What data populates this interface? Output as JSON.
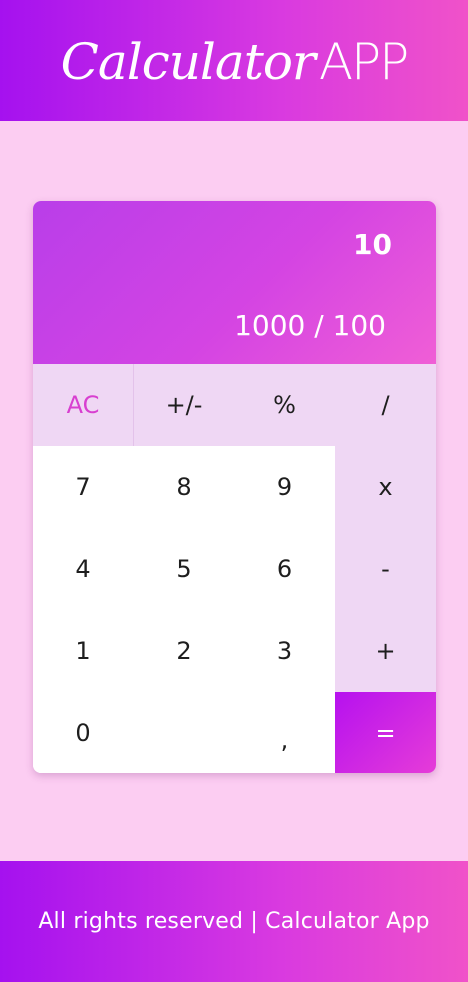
{
  "header": {
    "title_script": "Calculator",
    "title_app": "APP"
  },
  "display": {
    "result": "10",
    "expression": "1000 / 100"
  },
  "keys": {
    "ac": "AC",
    "sign": "+/-",
    "percent": "%",
    "divide": "/",
    "seven": "7",
    "eight": "8",
    "nine": "9",
    "multiply": "x",
    "four": "4",
    "five": "5",
    "six": "6",
    "minus": "-",
    "one": "1",
    "two": "2",
    "three": "3",
    "plus": "+",
    "zero": "0",
    "comma": ",",
    "equals": "="
  },
  "footer": {
    "text": "All rights reserved | Calculator App"
  },
  "colors": {
    "background": "#fccdf2",
    "accent_start": "#a511ef",
    "accent_end": "#f052c9",
    "key_function_bg": "#efd7f4",
    "ac_text": "#d83fd0"
  }
}
